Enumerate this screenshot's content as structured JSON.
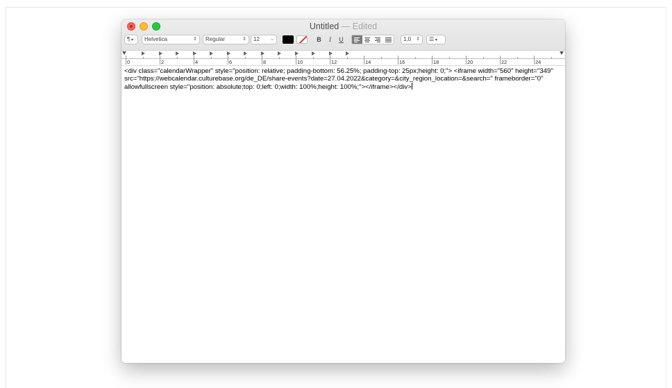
{
  "window": {
    "title": "Untitled",
    "title_suffix": "— Edited"
  },
  "toolbar": {
    "paragraph_style": "¶",
    "font_family": "Helvetica",
    "font_style": "Regular",
    "font_size": "12",
    "text_color": "#000000",
    "highlight_color": "none",
    "bold": "B",
    "italic": "I",
    "underline": "U",
    "alignment": "left",
    "line_spacing": "1,0",
    "list_icon": "list-bullets-icon"
  },
  "ruler": {
    "labels": [
      "0",
      "2",
      "4",
      "6",
      "8",
      "10",
      "12",
      "14",
      "16",
      "18",
      "20",
      "22",
      "24",
      "2"
    ]
  },
  "document": {
    "text": "<div class=\"calendarWrapper\" style=\"position: relative; padding-bottom: 56.25%; padding-top: 25px;height: 0;\"> <iframe width=\"560\" height=\"349\" src=\"https://webcalendar.culturebase.org/de_DE/share-events?date=27.04.2022&category=&city_region_location=&search=\" frameborder=\"0\" allowfullscreen style=\"position: absolute;top: 0;left: 0;width: 100%;height: 100%;\"></iframe></div>"
  },
  "colors": {
    "close": "#fe5f57",
    "minimize": "#febc2e",
    "maximize": "#28c840"
  }
}
